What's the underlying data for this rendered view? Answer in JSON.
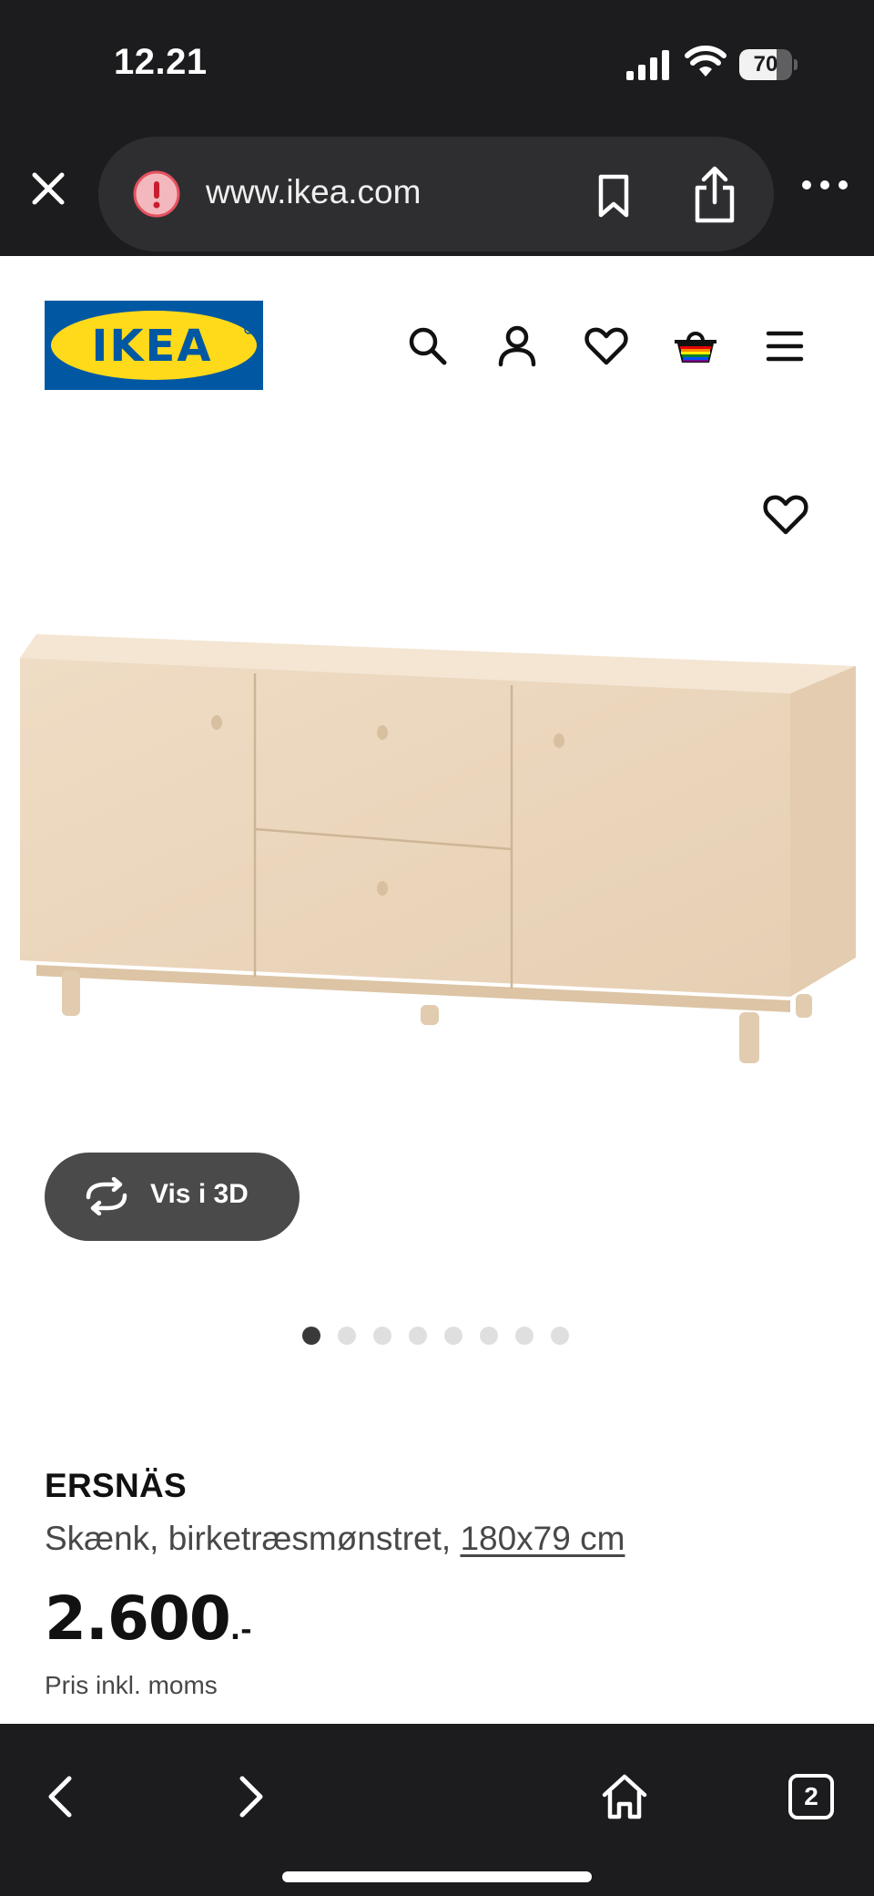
{
  "status_bar": {
    "time": "12.21",
    "battery_level": "70",
    "battery_fraction": 0.7,
    "icons": [
      "signal-icon",
      "wifi-icon",
      "battery-icon"
    ]
  },
  "browser": {
    "url": "www.ikea.com",
    "site_warning_icon": "warning-icon",
    "icons": [
      "close-icon",
      "warning-icon",
      "bookmark-icon",
      "share-icon",
      "more-icon"
    ]
  },
  "header": {
    "logo_text": "IKEA",
    "logo_colors": {
      "blue": "#0058A3",
      "yellow": "#FFDA1A"
    },
    "icons": [
      "search-icon",
      "account-icon",
      "heart-icon",
      "cart-icon",
      "menu-icon"
    ]
  },
  "gallery": {
    "view_3d_label": "Vis i 3D",
    "image_count": 8,
    "active_index": 0,
    "favorite_icon": "heart-icon"
  },
  "product": {
    "name": "ERSNÄS",
    "description": "Skænk, birketræsmønstret, ",
    "size": "180x79 cm",
    "price": "2.600",
    "price_suffix": ".-",
    "price_note": "Pris inkl. moms"
  },
  "toolbar": {
    "tab_count": "2",
    "icons": [
      "back-icon",
      "forward-icon",
      "home-icon",
      "tabs-icon"
    ]
  }
}
